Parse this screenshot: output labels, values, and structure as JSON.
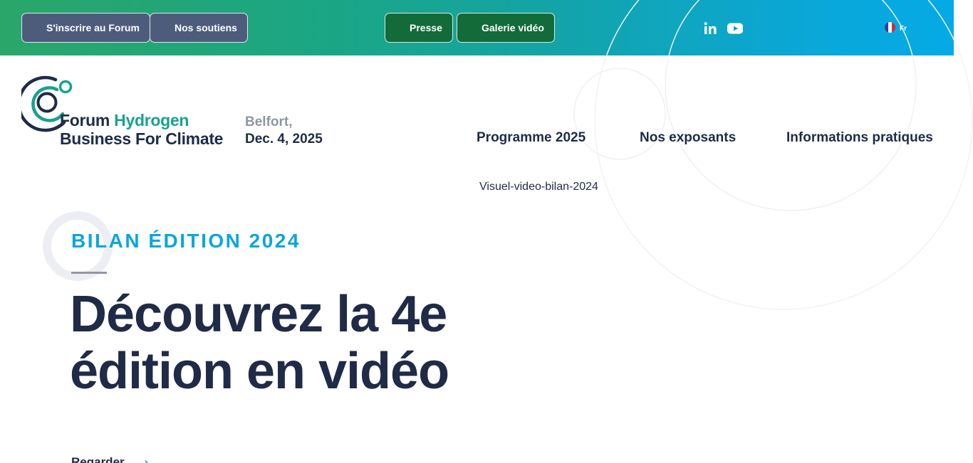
{
  "topbar": {
    "buttons": [
      {
        "label": "S'inscrire au Forum"
      },
      {
        "label": "Nos soutiens"
      },
      {
        "label": "Presse"
      },
      {
        "label": "Galerie vidéo"
      }
    ],
    "social": [
      "linkedin-icon",
      "youtube-icon"
    ],
    "language": {
      "label": "Fr",
      "flag": "france-flag-icon"
    }
  },
  "header": {
    "logo": {
      "line1_part1": "Forum ",
      "line1_part2": "Hydrogen",
      "line2": "Business For Climate"
    },
    "event": {
      "city": "Belfort,",
      "date": "Dec. 4, 2025"
    },
    "nav": [
      {
        "label": "Programme 2025"
      },
      {
        "label": "Nos exposants"
      },
      {
        "label": "Informations pratiques"
      }
    ]
  },
  "video": {
    "title": "Visuel-video-bilan-2024"
  },
  "hero": {
    "kicker": "BILAN ÉDITION 2024",
    "headline": "Découvrez la 4e édition en vidéo",
    "cta": "Regarder",
    "cta_icon": "chevron-right-icon"
  },
  "colors": {
    "navy": "#1f2b47",
    "cyan": "#0aa6dc",
    "green_button": "#136b3a",
    "slate_button": "#4e5c7c",
    "gray": "#8f96a6",
    "teal": "#18a290"
  }
}
